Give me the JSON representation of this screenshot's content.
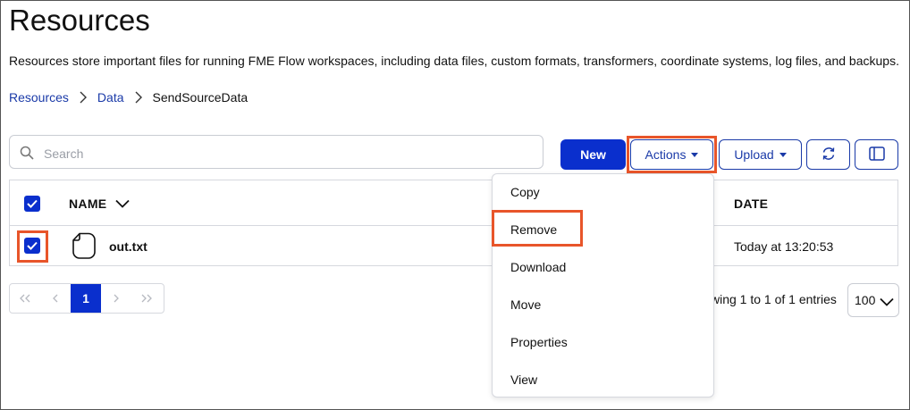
{
  "page": {
    "title": "Resources",
    "description": "Resources store important files for running FME Flow workspaces, including data files, custom formats, transformers, coordinate systems, log files, and backups."
  },
  "breadcrumb": {
    "items": [
      "Resources",
      "Data"
    ],
    "current": "SendSourceData"
  },
  "search": {
    "placeholder": "Search",
    "value": ""
  },
  "toolbar": {
    "new_label": "New",
    "actions_label": "Actions",
    "upload_label": "Upload",
    "refresh_icon": "refresh-icon",
    "columns_icon": "columns-icon"
  },
  "table": {
    "columns": [
      "NAME",
      "DATE"
    ],
    "select_all_checked": true,
    "rows": [
      {
        "name": "out.txt",
        "date": "Today at 13:20:53",
        "checked": true,
        "icon": "file-icon"
      }
    ]
  },
  "pagination": {
    "current_page": "1",
    "entries_text": "wing 1 to 1 of 1 entries",
    "page_size": "100"
  },
  "actions_menu": {
    "items": [
      "Copy",
      "Remove",
      "Download",
      "Move",
      "Properties",
      "View"
    ]
  },
  "colors": {
    "primary": "#0a2fcd",
    "link": "#1a3aa8",
    "highlight": "#e8552a"
  }
}
